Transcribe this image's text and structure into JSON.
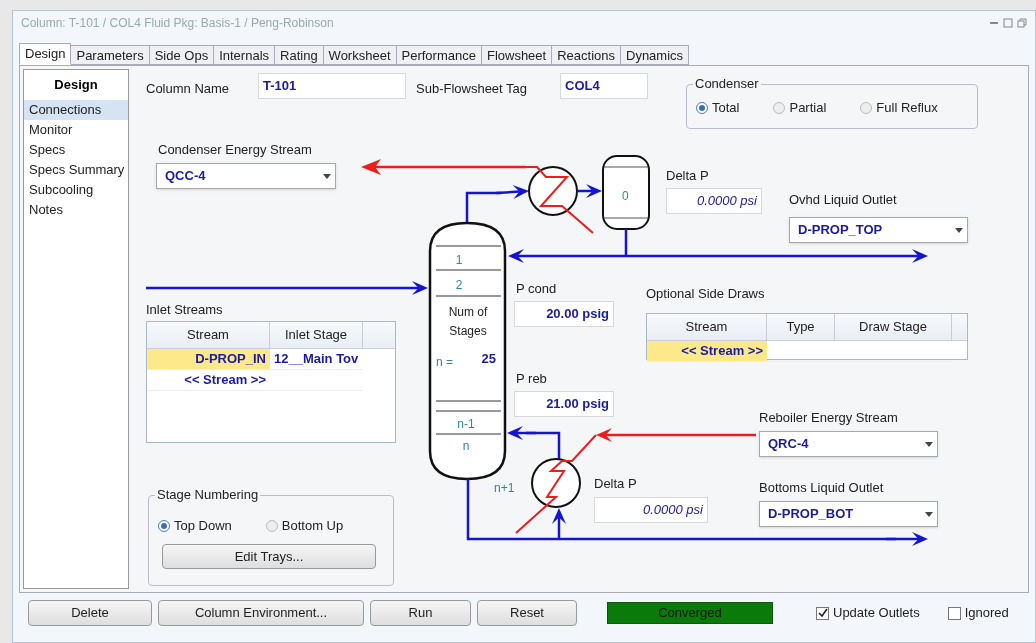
{
  "window": {
    "title": "Column: T-101 / COL4  Fluid Pkg: Basis-1 / Peng-Robinson"
  },
  "tabs": [
    {
      "label": "Design",
      "selected": true
    },
    {
      "label": "Parameters",
      "selected": false
    },
    {
      "label": "Side Ops",
      "selected": false
    },
    {
      "label": "Internals",
      "selected": false
    },
    {
      "label": "Rating",
      "selected": false
    },
    {
      "label": "Worksheet",
      "selected": false
    },
    {
      "label": "Performance",
      "selected": false
    },
    {
      "label": "Flowsheet",
      "selected": false
    },
    {
      "label": "Reactions",
      "selected": false
    },
    {
      "label": "Dynamics",
      "selected": false
    }
  ],
  "sidebar": {
    "heading": "Design",
    "items": [
      {
        "label": "Connections",
        "selected": true
      },
      {
        "label": "Monitor",
        "selected": false
      },
      {
        "label": "Specs",
        "selected": false
      },
      {
        "label": "Specs Summary",
        "selected": false
      },
      {
        "label": "Subcooling",
        "selected": false
      },
      {
        "label": "Notes",
        "selected": false
      }
    ]
  },
  "column_name": {
    "label": "Column Name",
    "value": "T-101"
  },
  "sub_flowsheet_tag": {
    "label": "Sub-Flowsheet Tag",
    "value": "COL4"
  },
  "condenser": {
    "label": "Condenser",
    "options": [
      {
        "label": "Total",
        "selected": true
      },
      {
        "label": "Partial",
        "selected": false
      },
      {
        "label": "Full Reflux",
        "selected": false
      }
    ]
  },
  "condenser_energy_stream": {
    "label": "Condenser Energy Stream",
    "value": "QCC-4"
  },
  "condenser_delta_p": {
    "label": "Delta P",
    "value": "0.0000 psi"
  },
  "ovhd_liquid_outlet": {
    "label": "Ovhd Liquid Outlet",
    "value": "D-PROP_TOP"
  },
  "column_diagram": {
    "drum_label": "0",
    "top_stages": [
      "1",
      "2"
    ],
    "num_stages_label": "Num of Stages",
    "n_label": "n =",
    "num_stages": "25",
    "bottom_stages": [
      "n-1",
      "n"
    ],
    "reboiler_stage": "n+1"
  },
  "p_cond": {
    "label": "P cond",
    "value": "20.00 psig"
  },
  "p_reb": {
    "label": "P reb",
    "value": "21.00 psig"
  },
  "inlet_streams": {
    "label": "Inlet Streams",
    "columns": [
      "Stream",
      "Inlet Stage"
    ],
    "rows": [
      {
        "stream": "D-PROP_IN",
        "inlet_stage": "12__Main Tov",
        "selected": true
      },
      {
        "stream": "<< Stream >>",
        "selected": false
      }
    ]
  },
  "side_draws": {
    "label": "Optional Side Draws",
    "columns": [
      "Stream",
      "Type",
      "Draw Stage"
    ],
    "rows": [
      {
        "stream": "<< Stream >>",
        "selected": true
      }
    ]
  },
  "reboiler_energy_stream": {
    "label": "Reboiler Energy Stream",
    "value": "QRC-4"
  },
  "reboiler_delta_p": {
    "label": "Delta P",
    "value": "0.0000 psi"
  },
  "bottoms_liquid_outlet": {
    "label": "Bottoms Liquid Outlet",
    "value": "D-PROP_BOT"
  },
  "stage_numbering": {
    "label": "Stage Numbering",
    "options": [
      {
        "label": "Top Down",
        "selected": true
      },
      {
        "label": "Bottom Up",
        "selected": false
      }
    ],
    "edit_button": "Edit Trays..."
  },
  "buttons": [
    "Delete",
    "Column Environment...",
    "Run",
    "Reset"
  ],
  "status": {
    "text": "Converged",
    "converged": true
  },
  "checkboxes": [
    {
      "label": "Update Outlets",
      "checked": true
    },
    {
      "label": "Ignored",
      "checked": false
    }
  ]
}
